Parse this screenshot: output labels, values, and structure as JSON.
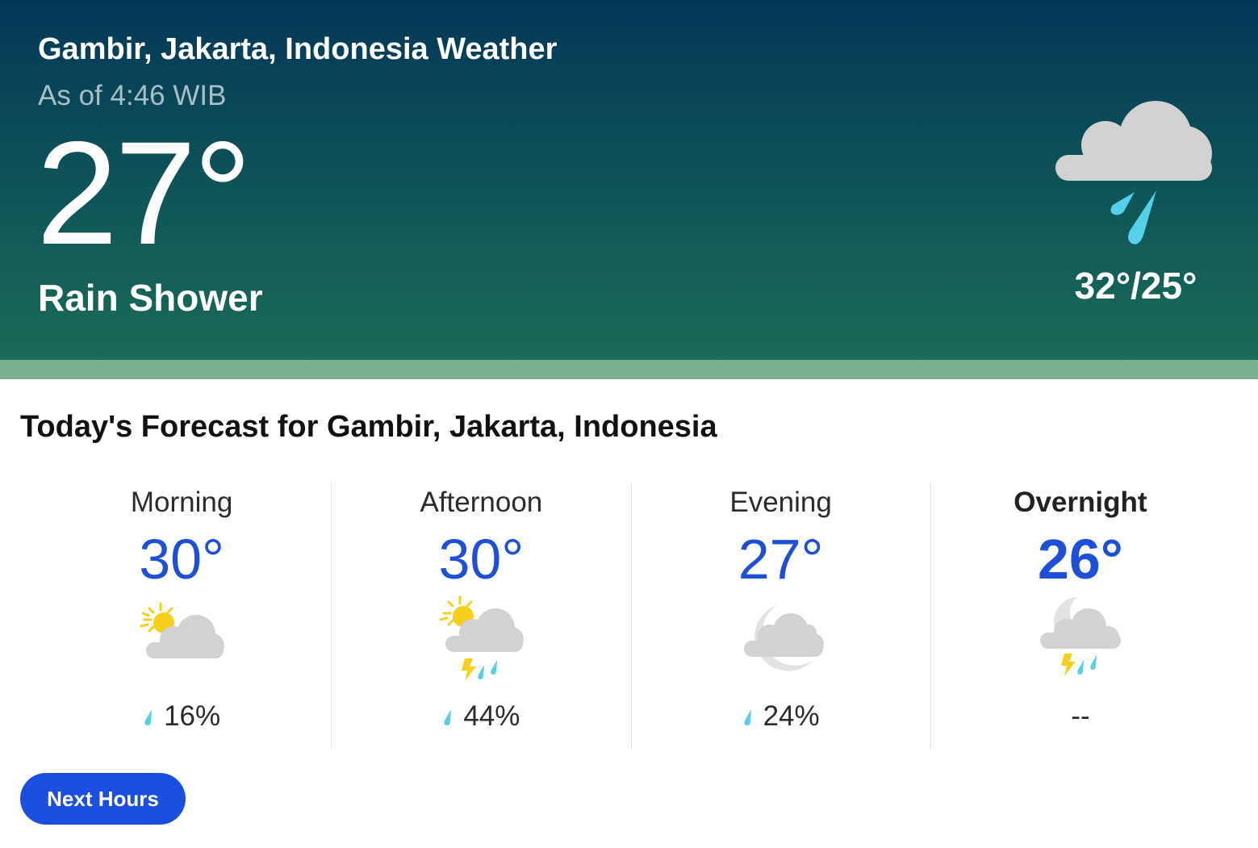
{
  "hero": {
    "location": "Gambir, Jakarta, Indonesia Weather",
    "as_of": "As of 4:46 WIB",
    "temperature": "27°",
    "phrase": "Rain Shower",
    "hi_lo": "32°/25°",
    "icon": "rain-shower-icon"
  },
  "forecast": {
    "title": "Today's Forecast for Gambir, Jakarta, Indonesia",
    "periods": [
      {
        "label": "Morning",
        "temp": "30°",
        "icon": "partly-sunny-icon",
        "precip": "16%"
      },
      {
        "label": "Afternoon",
        "temp": "30°",
        "icon": "sun-thunderstorm-icon",
        "precip": "44%"
      },
      {
        "label": "Evening",
        "temp": "27°",
        "icon": "partly-cloudy-night-icon",
        "precip": "24%"
      },
      {
        "label": "Overnight",
        "temp": "26°",
        "icon": "night-thunderstorm-icon",
        "precip": "--"
      }
    ],
    "next_button": "Next Hours"
  },
  "colors": {
    "accent": "#1b4fe0",
    "temp_blue": "#1e4fd8",
    "rain_drop": "#56cfe8",
    "sun": "#f4d01d",
    "cloud": "#d2d2d2"
  }
}
